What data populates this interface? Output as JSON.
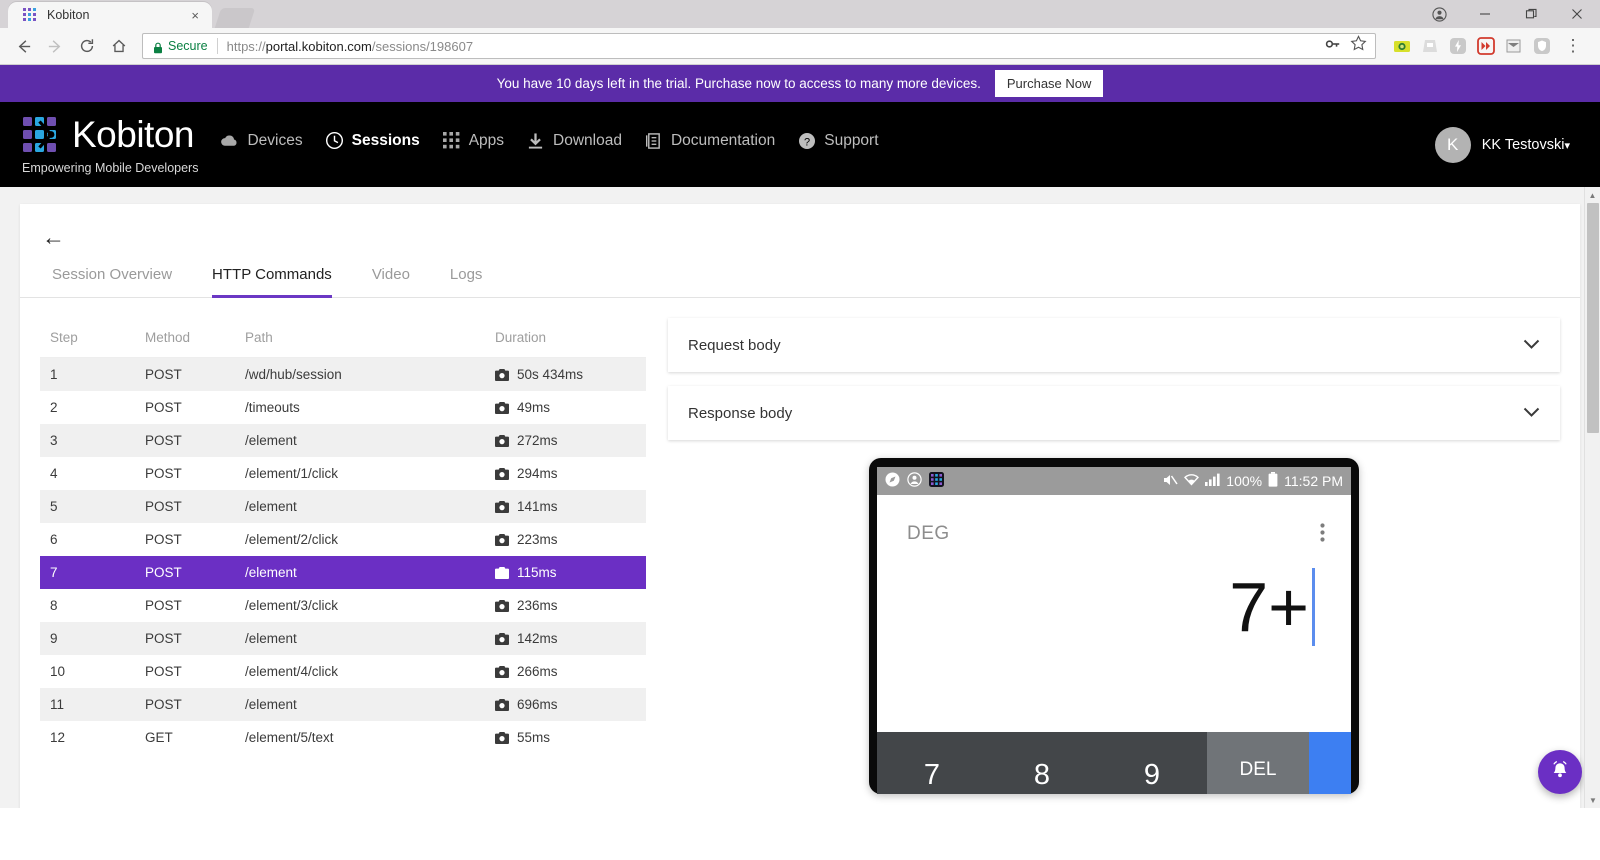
{
  "browser": {
    "tab": {
      "title": "Kobiton",
      "favicon": "kobiton-favicon",
      "close": "×"
    },
    "newtab_label": "+",
    "window_controls": {
      "profile": "●",
      "minimize": "—",
      "maximize": "❐",
      "close": "✕"
    },
    "nav": {
      "back": "←",
      "forward": "→",
      "reload": "↻",
      "home": "⌂"
    },
    "omnibox": {
      "secure_label": "Secure",
      "url_scheme": "https://",
      "url_host": "portal.kobiton.com",
      "url_path": "/sessions/198607",
      "key_icon": "key-icon",
      "star_icon": "star-icon"
    },
    "extensions": [
      "camera-extension-icon",
      "save-extension-icon",
      "lightning-extension-icon",
      "forward-extension-icon",
      "mail-extension-icon",
      "shield-extension-icon"
    ],
    "menu_icon": "⋮"
  },
  "banner": {
    "message": "You have 10 days left in the trial. Purchase now to access to many more devices.",
    "button": "Purchase Now",
    "bg_color": "#5b2ca8"
  },
  "nav": {
    "brand": "Kobiton",
    "tagline": "Empowering Mobile Developers",
    "links": [
      {
        "label": "Devices",
        "icon": "cloud-icon",
        "active": false
      },
      {
        "label": "Sessions",
        "icon": "clock-icon",
        "active": true
      },
      {
        "label": "Apps",
        "icon": "grid-icon",
        "active": false
      },
      {
        "label": "Download",
        "icon": "download-icon",
        "active": false
      },
      {
        "label": "Documentation",
        "icon": "document-icon",
        "active": false
      },
      {
        "label": "Support",
        "icon": "question-circle-icon",
        "active": false
      }
    ],
    "user": {
      "initial": "K",
      "name": "KK Testovski",
      "caret": "▾"
    }
  },
  "session": {
    "back_arrow": "←",
    "tabs": [
      {
        "label": "Session Overview",
        "active": false
      },
      {
        "label": "HTTP Commands",
        "active": true
      },
      {
        "label": "Video",
        "active": false
      },
      {
        "label": "Logs",
        "active": false
      }
    ],
    "accent_color": "#6b38c4"
  },
  "commands_table": {
    "columns": [
      "Step",
      "Method",
      "Path",
      "Duration"
    ],
    "rows": [
      {
        "step": "1",
        "method": "POST",
        "path": "/wd/hub/session",
        "duration": "50s 434ms",
        "selected": false
      },
      {
        "step": "2",
        "method": "POST",
        "path": "/timeouts",
        "duration": "49ms",
        "selected": false
      },
      {
        "step": "3",
        "method": "POST",
        "path": "/element",
        "duration": "272ms",
        "selected": false
      },
      {
        "step": "4",
        "method": "POST",
        "path": "/element/1/click",
        "duration": "294ms",
        "selected": false
      },
      {
        "step": "5",
        "method": "POST",
        "path": "/element",
        "duration": "141ms",
        "selected": false
      },
      {
        "step": "6",
        "method": "POST",
        "path": "/element/2/click",
        "duration": "223ms",
        "selected": false
      },
      {
        "step": "7",
        "method": "POST",
        "path": "/element",
        "duration": "115ms",
        "selected": true
      },
      {
        "step": "8",
        "method": "POST",
        "path": "/element/3/click",
        "duration": "236ms",
        "selected": false
      },
      {
        "step": "9",
        "method": "POST",
        "path": "/element",
        "duration": "142ms",
        "selected": false
      },
      {
        "step": "10",
        "method": "POST",
        "path": "/element/4/click",
        "duration": "266ms",
        "selected": false
      },
      {
        "step": "11",
        "method": "POST",
        "path": "/element",
        "duration": "696ms",
        "selected": false
      },
      {
        "step": "12",
        "method": "GET",
        "path": "/element/5/text",
        "duration": "55ms",
        "selected": false
      }
    ],
    "selected_row_color": "#6b2fc4"
  },
  "panels": [
    {
      "title": "Request body",
      "chevron": "⌄",
      "expanded": false
    },
    {
      "title": "Response body",
      "chevron": "⌄",
      "expanded": false
    }
  ],
  "device_preview": {
    "statusbar": {
      "left_icons": [
        "compass-icon",
        "account-icon",
        "kobiton-app-icon"
      ],
      "mute_icon": "mute-icon",
      "wifi_icon": "wifi-icon",
      "signal_icon": "signal-icon",
      "battery_text": "100%",
      "battery_icon": "battery-full-icon",
      "time": "11:52 PM"
    },
    "calculator": {
      "mode": "DEG",
      "overflow_icon": "⋮",
      "expression": "7+",
      "keys": [
        "7",
        "8",
        "9"
      ],
      "delete_key": "DEL",
      "accent_key_color": "#3d7ff2"
    }
  },
  "fab": {
    "icon": "bell-icon",
    "color": "#6b2fc4"
  },
  "scrollbar": {
    "up": "▲",
    "down": "▼"
  }
}
